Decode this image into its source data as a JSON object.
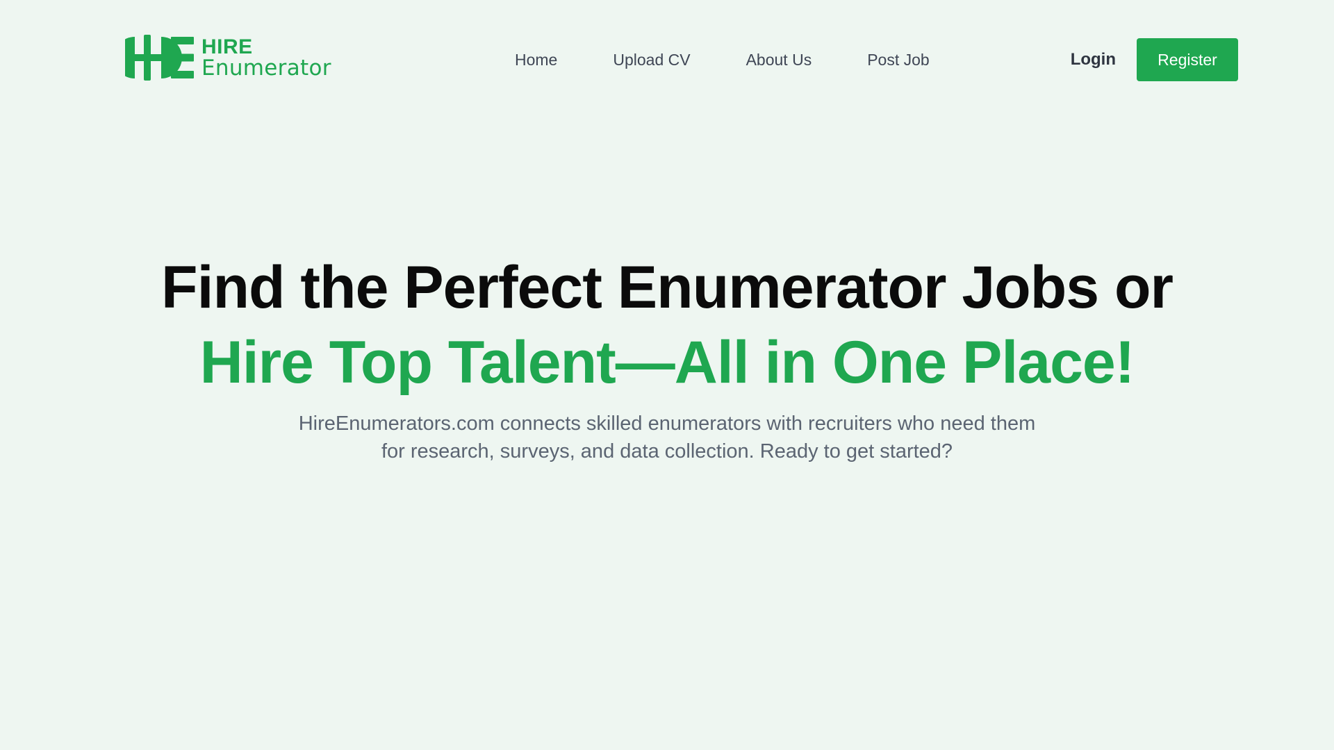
{
  "brand": {
    "name_top": "HIRE",
    "name_bottom": "Enumerator",
    "color": "#1fa750"
  },
  "nav": {
    "items": [
      {
        "label": "Home"
      },
      {
        "label": "Upload CV"
      },
      {
        "label": "About Us"
      },
      {
        "label": "Post Job"
      }
    ]
  },
  "auth": {
    "login_label": "Login",
    "register_label": "Register"
  },
  "hero": {
    "title_line1": "Find the Perfect Enumerator Jobs or",
    "title_line2": "Hire Top Talent—All in One Place!",
    "subtitle": "HireEnumerators.com connects skilled enumerators with recruiters who need them for research, surveys, and data collection. Ready to get started?"
  },
  "colors": {
    "background": "#eef6f1",
    "accent": "#1fa750",
    "heading": "#0b0b0b",
    "body_text": "#5b6472"
  }
}
